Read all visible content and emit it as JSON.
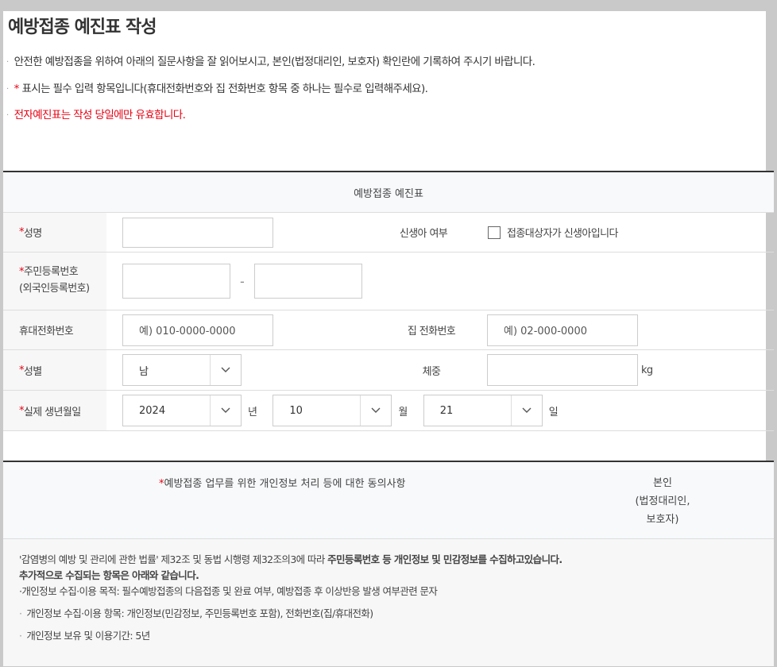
{
  "title": "예방접종 예진표 작성",
  "notices": {
    "n1": "안전한 예방접종을 위하여 아래의 질문사항을 잘 읽어보시고, 본인(법정대리인, 보호자) 확인란에 기록하여 주시기 바랍니다.",
    "n2_star": "*",
    "n2": " 표시는 필수 입력 항목입니다(휴대전화번호와 집 전화번호 항목 중 하나는 필수로 입력해주세요).",
    "n3": "전자예진표는 작성 당일에만 유효합니다."
  },
  "form": {
    "header": "예방접종 예진표",
    "star": "*",
    "name_label": "성명",
    "newborn_label": "신생아 여부",
    "newborn_check_label": "접종대상자가 신생아입니다",
    "rrn_label_1": "주민등록번호",
    "rrn_label_2": "(외국인등록번호)",
    "rrn_dash": "-",
    "mobile_label": "휴대전화번호",
    "mobile_placeholder": "예) 010-0000-0000",
    "home_label": "집 전화번호",
    "home_placeholder": "예) 02-000-0000",
    "gender_label": "성별",
    "gender_value": "남",
    "weight_label": "체중",
    "weight_unit": "kg",
    "birth_label": "실제 생년월일",
    "year_value": "2024",
    "year_unit": "년",
    "month_value": "10",
    "month_unit": "월",
    "day_value": "21",
    "day_unit": "일"
  },
  "consent": {
    "header": "예방접종 업무를 위한 개인정보 처리 등에 대한 동의사항",
    "self_1": "본인",
    "self_2": "(법정대리인,",
    "self_3": "보호자)",
    "law_text": "'감염병의 예방 및 관리에 관한 법률' 제32조 및 동법 시행령 제32조의3에 따라 ",
    "law_bold": "주민등록번호 등 개인정보 및 민감정보를 수집하고있습니다.",
    "extra_bold": "추가적으로 수집되는 항목은 아래와 같습니다.",
    "purpose": "개인정보 수집·이용 목적: 필수예방접종의 다음접종 및 완료 여부, 예방접종 후 이상반응 발생 여부관련 문자",
    "items": "개인정보 수집·이용 항목: 개인정보(민감정보, 주민등록번호 포함), 전화번호(집/휴대전화)",
    "retention": "개인정보 보유 및 이용기간: 5년"
  },
  "colors": {
    "required": "#e60012",
    "header_bg": "#f7f9fb",
    "label_bg": "#f7f7f7"
  }
}
